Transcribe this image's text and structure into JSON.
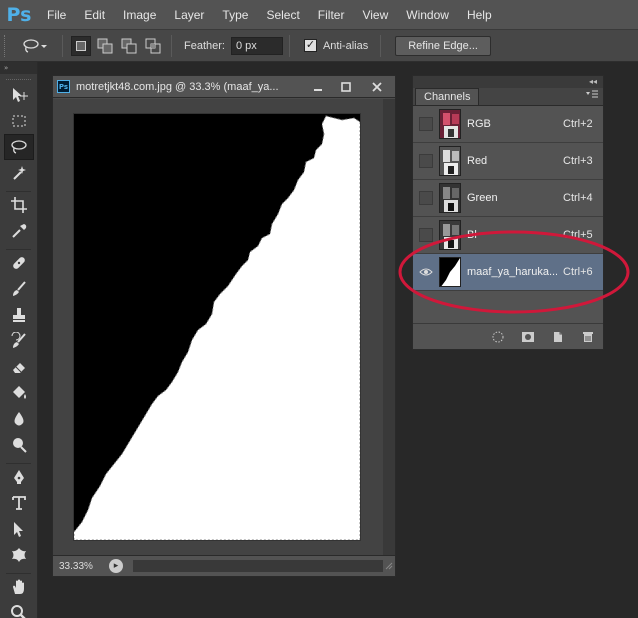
{
  "app": {
    "logo": "Ps"
  },
  "menu": [
    "File",
    "Edit",
    "Image",
    "Layer",
    "Type",
    "Select",
    "Filter",
    "View",
    "Window",
    "Help"
  ],
  "options": {
    "feather_label": "Feather:",
    "feather_value": "0 px",
    "antialias_label": "Anti-alias",
    "antialias_checked": true,
    "refine_label": "Refine Edge..."
  },
  "toolbar": {
    "collapse_glyph": "»"
  },
  "document": {
    "title": "motretjkt48.com.jpg @ 33.3% (maaf_ya...",
    "zoom": "33.33%"
  },
  "panel": {
    "tab": "Channels",
    "collapse_glyph": "◂◂",
    "channels": [
      {
        "name": "RGB",
        "shortcut": "Ctrl+2",
        "visible": false,
        "selected": false
      },
      {
        "name": "Red",
        "shortcut": "Ctrl+3",
        "visible": false,
        "selected": false
      },
      {
        "name": "Green",
        "shortcut": "Ctrl+4",
        "visible": false,
        "selected": false
      },
      {
        "name": "Bl",
        "shortcut": "Ctrl+5",
        "visible": false,
        "selected": false
      },
      {
        "name": "maaf_ya_haruka...",
        "shortcut": "Ctrl+6",
        "visible": true,
        "selected": true
      }
    ]
  },
  "colors": {
    "annotation": "#d0183a",
    "selection_row": "#5f7088",
    "ps_blue": "#4fb0e8"
  }
}
